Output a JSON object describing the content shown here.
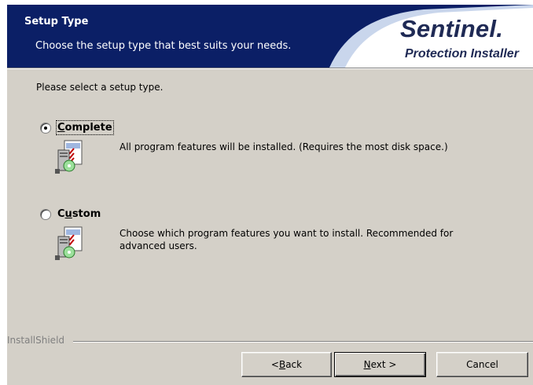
{
  "header": {
    "title": "Setup Type",
    "subtitle": "Choose the setup type that best suits your needs.",
    "brand_name": "Sentinel",
    "brand_dot": ".",
    "brand_tagline": "Protection Installer"
  },
  "main": {
    "prompt": "Please select a setup type.",
    "options": [
      {
        "label_before": "",
        "label_key": "C",
        "label_after": "omplete",
        "selected": true,
        "description": "All program features will be installed. (Requires the most disk space.)",
        "icon": "setup-complete-icon"
      },
      {
        "label_before": "C",
        "label_key": "u",
        "label_after": "stom",
        "selected": false,
        "description": "Choose which program features you want to install. Recommended for advanced users.",
        "icon": "setup-custom-icon"
      }
    ]
  },
  "footer": {
    "brand": "InstallShield",
    "buttons": {
      "back": {
        "before": "< ",
        "key": "B",
        "after": "ack"
      },
      "next": {
        "before": "",
        "key": "N",
        "after": "ext >"
      },
      "cancel": {
        "label": "Cancel"
      }
    }
  },
  "colors": {
    "banner": "#0b1f66",
    "dialog_bg": "#d4d0c8",
    "brand_text": "#1f2a55"
  }
}
